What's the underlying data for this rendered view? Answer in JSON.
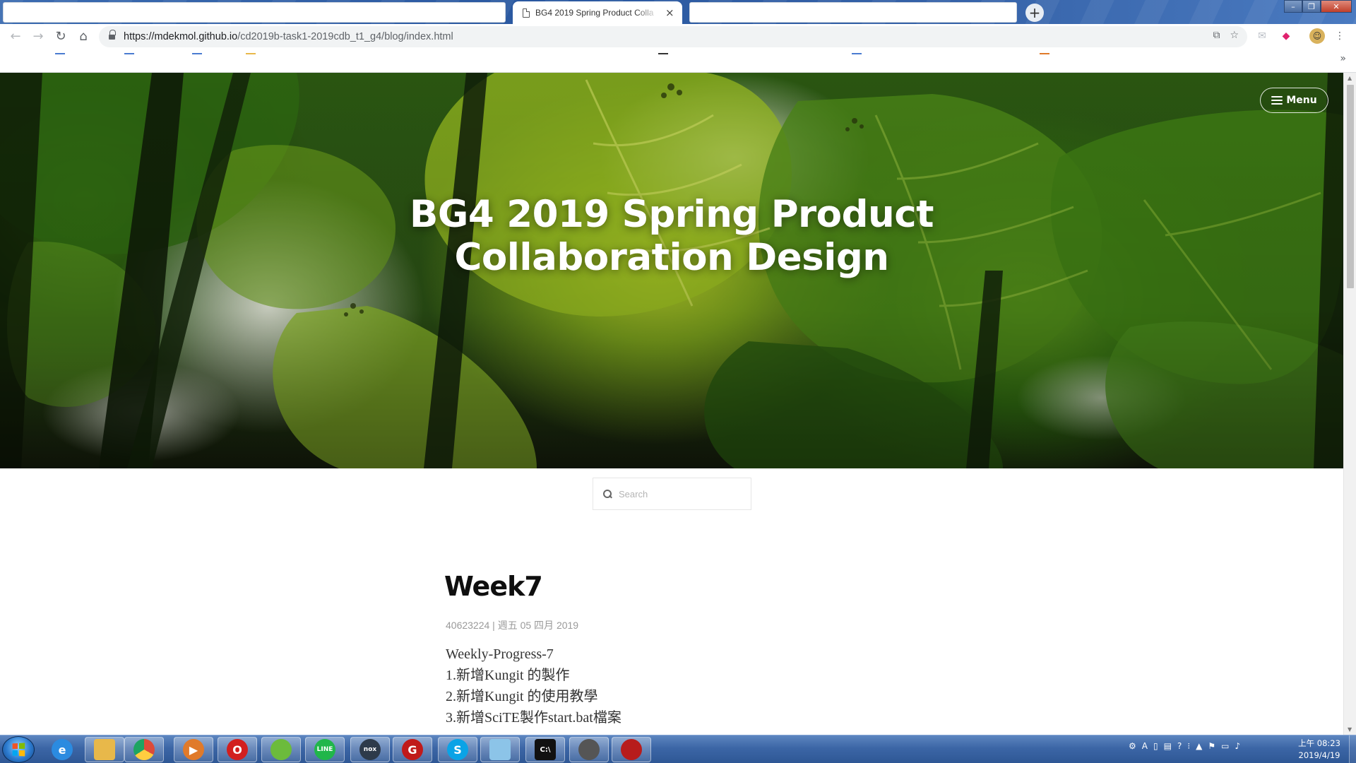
{
  "browser": {
    "active_tab_title": "BG4 2019 Spring Product Colla",
    "tab_close": "×",
    "new_tab": "+",
    "url_host": "https://mdekmol.github.io",
    "url_path": "/cd2019b-task1-2019cdb_t1_g4/blog/index.html",
    "bookmarks_more": "»"
  },
  "page": {
    "menu_label": "Menu",
    "site_title": "BG4 2019 Spring Product Collaboration Design",
    "search_placeholder": "Search",
    "post": {
      "title": "Week7",
      "meta": "40623224 | 週五 05 四月 2019",
      "lines": [
        "Weekly-Progress-7",
        "1.新增Kungit 的製作",
        "2.新增Kungit 的使用教學",
        "3.新增SciTE製作start.bat檔案"
      ]
    }
  },
  "taskbar": {
    "apps": [
      {
        "name": "ie",
        "glyph": "e",
        "color": "#2b8be0"
      },
      {
        "name": "explorer",
        "glyph": "",
        "color": "#e8b84a"
      },
      {
        "name": "chrome",
        "glyph": "",
        "color": "#dd4b39"
      },
      {
        "name": "media-player",
        "glyph": "▶",
        "color": "#e07a2a"
      },
      {
        "name": "opera",
        "glyph": "O",
        "color": "#d21f1f"
      },
      {
        "name": "bluestacks",
        "glyph": "",
        "color": "#6cbb3c"
      },
      {
        "name": "line",
        "glyph": "LINE",
        "color": "#20b64a"
      },
      {
        "name": "nox",
        "glyph": "nox",
        "color": "#2d3a4a"
      },
      {
        "name": "garena",
        "glyph": "G",
        "color": "#c01a1a"
      },
      {
        "name": "skype",
        "glyph": "S",
        "color": "#0aa3e6"
      },
      {
        "name": "notepad",
        "glyph": "",
        "color": "#8cc4e8"
      },
      {
        "name": "cmd",
        "glyph": "C:\\",
        "color": "#111111"
      },
      {
        "name": "sphere",
        "glyph": "",
        "color": "#555555"
      },
      {
        "name": "game",
        "glyph": "",
        "color": "#b71c1c"
      }
    ],
    "clock_time": "上午 08:23",
    "clock_date": "2019/4/19"
  }
}
